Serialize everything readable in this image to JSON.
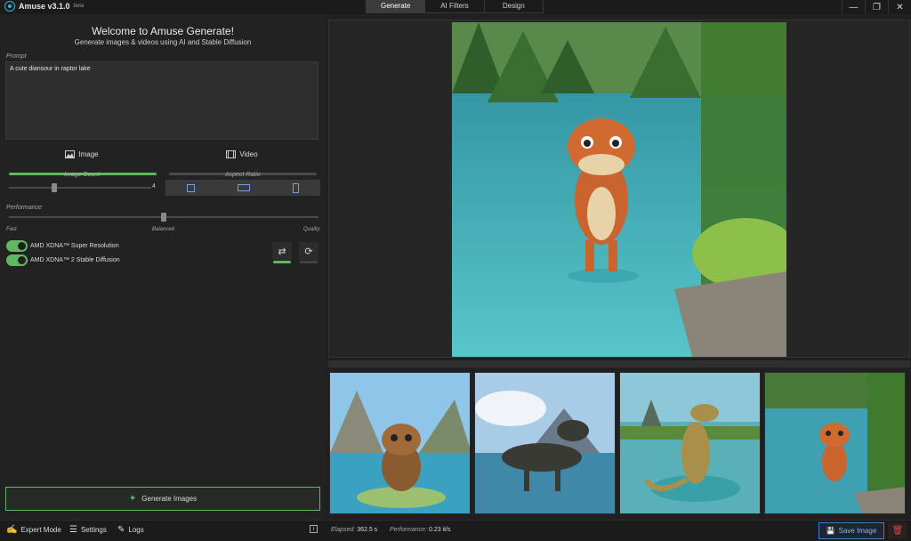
{
  "app": {
    "title": "Amuse v3.1.0",
    "badge": "beta"
  },
  "tabs": [
    "Generate",
    "AI Filters",
    "Design"
  ],
  "window_controls": [
    "minimize",
    "restore",
    "close"
  ],
  "header": {
    "welcome": "Welcome to Amuse Generate!",
    "subtitle": "Generate images & videos using AI and Stable Diffusion"
  },
  "prompt": {
    "label": "Prompt",
    "value": "A cute diansour in raptor lake"
  },
  "mode": {
    "image": "Image",
    "video": "Video",
    "selected": "image"
  },
  "image_count": {
    "label": "Image Count",
    "value": "4",
    "fraction": 0.32
  },
  "aspect_ratio": {
    "label": "Aspect Ratio",
    "options": [
      "square",
      "landscape",
      "portrait"
    ]
  },
  "performance": {
    "label": "Performance",
    "fast": "Fast",
    "balanced": "Balanced",
    "quality": "Quality",
    "fraction": 0.5
  },
  "toggles": [
    {
      "label": "AMD XDNA™ Super Resolution",
      "on": true
    },
    {
      "label": "AMD XDNA™ 2 Stable Diffusion",
      "on": true
    }
  ],
  "generate_button": "Generate Images",
  "statusbar": {
    "expert_mode": "Expert Mode",
    "settings": "Settings",
    "logs": "Logs",
    "elapsed_label": "Elapsed:",
    "elapsed_value": "362.5 s",
    "performance_label": "Performance:",
    "performance_value": "0.23 it/s",
    "save_image": "Save Image"
  },
  "colors": {
    "accent_green": "#5fb85f",
    "accent_blue": "#3b7fc4",
    "delete_red": "#d24848"
  }
}
